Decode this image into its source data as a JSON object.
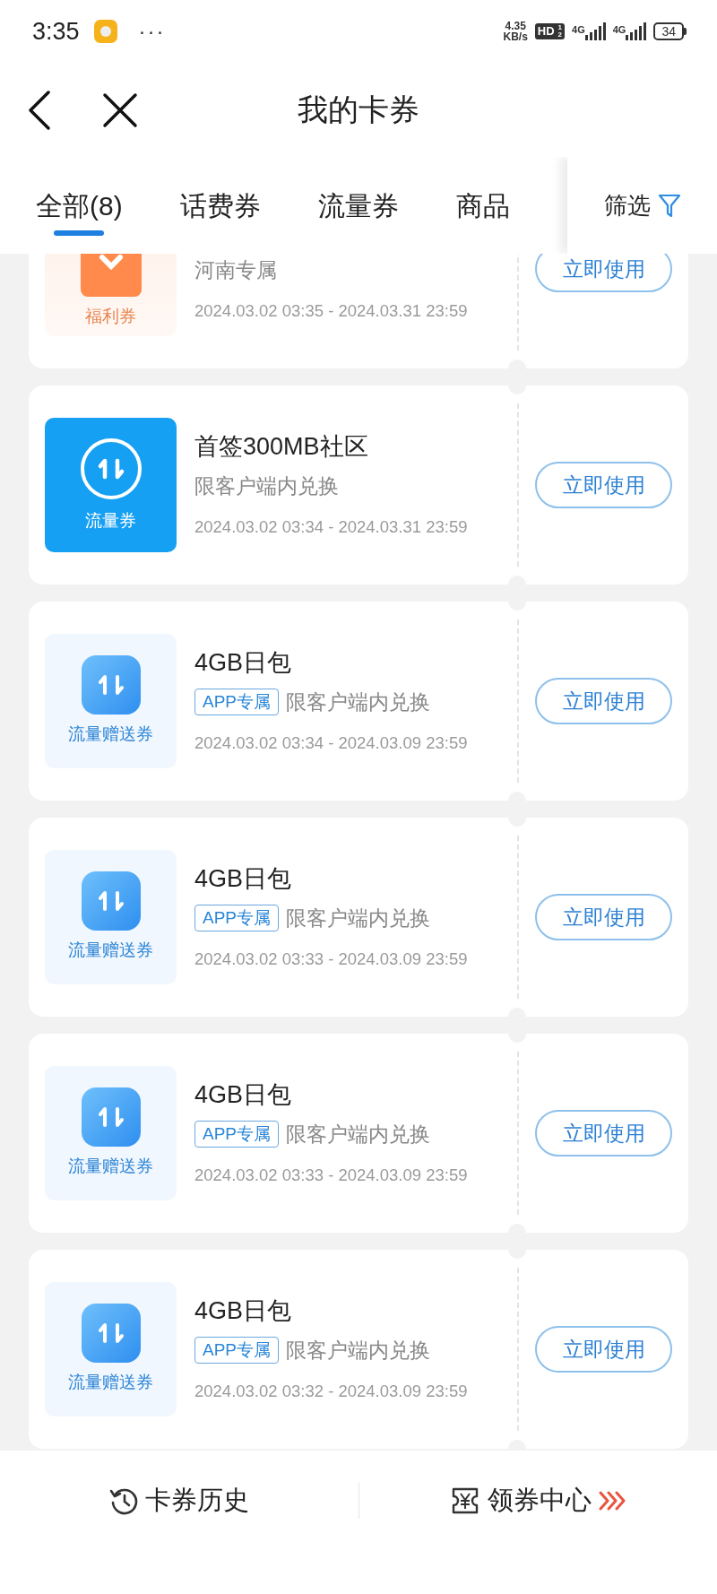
{
  "status_bar": {
    "time": "3:35",
    "more": "···",
    "net_speed": "4.35",
    "net_unit": "KB/s",
    "hd": "HD",
    "sim_marks": [
      "1",
      "2"
    ],
    "networks": [
      "4G",
      "4G"
    ],
    "battery": "34"
  },
  "header": {
    "title": "我的卡券"
  },
  "tabs": [
    {
      "label": "全部(8)",
      "selected": true
    },
    {
      "label": "话费券",
      "selected": false
    },
    {
      "label": "流量券",
      "selected": false
    },
    {
      "label": "商品",
      "selected": false
    }
  ],
  "filter": {
    "label": "筛选"
  },
  "coupons": [
    {
      "kind": "welfare",
      "badge": "福利券",
      "subtitle": "河南专属",
      "validity": "2024.03.02 03:35 - 2024.03.31 23:59",
      "action": "立即使用"
    },
    {
      "kind": "flow",
      "badge": "流量券",
      "title": "首签300MB社区",
      "subtitle": "限客户端内兑换",
      "validity": "2024.03.02 03:34 - 2024.03.31 23:59",
      "action": "立即使用"
    },
    {
      "kind": "gift",
      "badge": "流量赠送券",
      "title": "4GB日包",
      "tag": "APP专属",
      "subtitle": "限客户端内兑换",
      "validity": "2024.03.02 03:34 - 2024.03.09 23:59",
      "action": "立即使用"
    },
    {
      "kind": "gift",
      "badge": "流量赠送券",
      "title": "4GB日包",
      "tag": "APP专属",
      "subtitle": "限客户端内兑换",
      "validity": "2024.03.02 03:33 - 2024.03.09 23:59",
      "action": "立即使用"
    },
    {
      "kind": "gift",
      "badge": "流量赠送券",
      "title": "4GB日包",
      "tag": "APP专属",
      "subtitle": "限客户端内兑换",
      "validity": "2024.03.02 03:33 - 2024.03.09 23:59",
      "action": "立即使用"
    },
    {
      "kind": "gift",
      "badge": "流量赠送券",
      "title": "4GB日包",
      "tag": "APP专属",
      "subtitle": "限客户端内兑换",
      "validity": "2024.03.02 03:32 - 2024.03.09 23:59",
      "action": "立即使用"
    }
  ],
  "footer": [
    {
      "kind": "history",
      "label": "卡券历史"
    },
    {
      "kind": "center",
      "label": "领券中心"
    }
  ]
}
